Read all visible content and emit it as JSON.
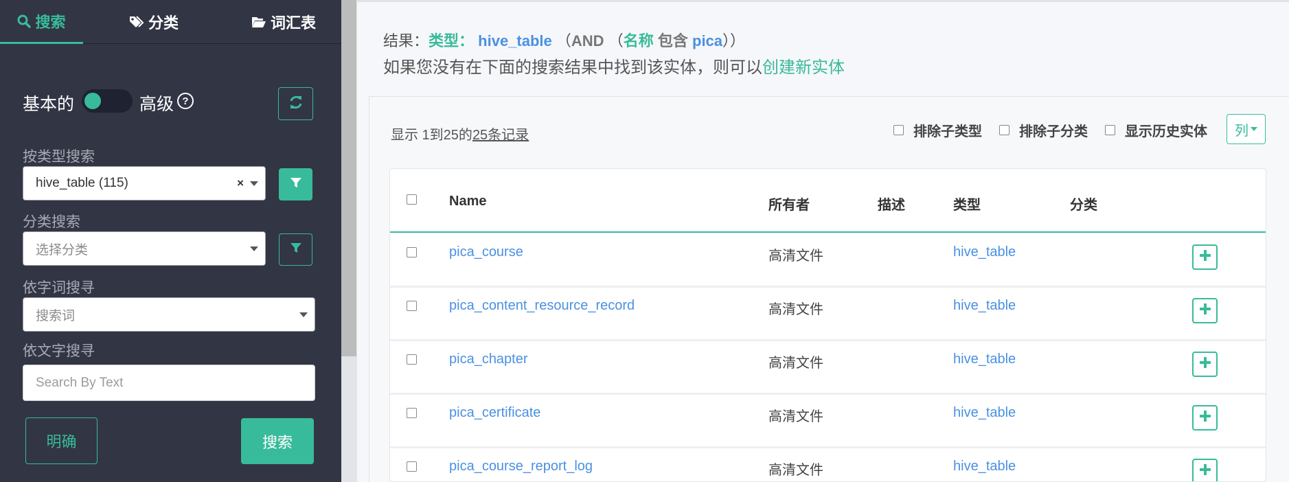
{
  "sidebar": {
    "tabs": [
      {
        "label": "搜索",
        "icon": "search-icon"
      },
      {
        "label": "分类",
        "icon": "tags-icon"
      },
      {
        "label": "词汇表",
        "icon": "folder-open-icon"
      }
    ],
    "toggle": {
      "basic_label": "基本的",
      "advanced_label": "高级"
    },
    "type_search": {
      "label": "按类型搜索",
      "value": "hive_table (115)",
      "clear": "×"
    },
    "classification_search": {
      "label": "分类搜索",
      "placeholder": "选择分类"
    },
    "term_search": {
      "label": "依字词搜寻",
      "placeholder": "搜索词"
    },
    "text_search": {
      "label": "依文字搜寻",
      "placeholder": "Search By Text"
    },
    "clear_label": "明确",
    "search_label": "搜索"
  },
  "main": {
    "result": {
      "prefix": "结果：",
      "type_key": "类型：",
      "type_value": "hive_table",
      "open1": "（",
      "and": "AND",
      "open2": "（",
      "name_key": "名称",
      "contains": "包含",
      "name_value": "pica",
      "close": "））"
    },
    "hint": {
      "text": "如果您没有在下面的搜索结果中找到该实体，则可以",
      "link": "创建新实体"
    },
    "records": {
      "prefix": "显示 1到25的",
      "link": "25条记录"
    },
    "options": {
      "exclude_subtypes": "排除子类型",
      "exclude_subclassifications": "排除子分类",
      "show_historical": "显示历史实体"
    },
    "columns_button": "列",
    "table": {
      "headers": {
        "name": "Name",
        "owner": "所有者",
        "description": "描述",
        "type": "类型",
        "classification": "分类"
      },
      "rows": [
        {
          "name": "pica_course",
          "owner": "高清文件",
          "type": "hive_table"
        },
        {
          "name": "pica_content_resource_record",
          "owner": "高清文件",
          "type": "hive_table"
        },
        {
          "name": "pica_chapter",
          "owner": "高清文件",
          "type": "hive_table"
        },
        {
          "name": "pica_certificate",
          "owner": "高清文件",
          "type": "hive_table"
        },
        {
          "name": "pica_course_report_log",
          "owner": "高清文件",
          "type": "hive_table"
        }
      ]
    }
  },
  "colors": {
    "accent": "#38bb9b",
    "link": "#4a90e2",
    "sidebar_bg": "#323544"
  }
}
